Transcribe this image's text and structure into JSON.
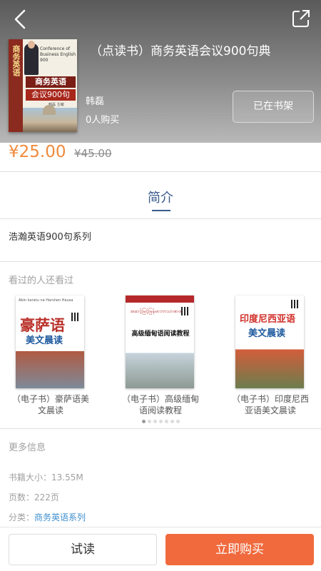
{
  "header": {
    "back_icon": "chevron-left-icon",
    "share_icon": "share-out-icon",
    "book": {
      "title": "（点读书）商务英语会议900句典",
      "author": "韩磊",
      "buyers": "0人购买",
      "shelf_button": "已在书架",
      "cover": {
        "spine_text": "商务英语",
        "en_text": "Conference of Business English 900",
        "title_line1": "商务英语",
        "title_line2": "会议900句",
        "author": "韩磊 主编"
      }
    }
  },
  "price": {
    "current": "¥25.00",
    "original": "¥45.00",
    "accent_color": "#f08a3c"
  },
  "tabs": {
    "intro": "简介"
  },
  "intro": {
    "text": "浩瀚英语900句系列"
  },
  "recommend": {
    "label": "看过的人还看过",
    "items": [
      {
        "caption": "（电子书）豪萨语美文晨读",
        "cover_small": "Abin karatu na Harshen Hausa",
        "cover_title_red": "豪萨语",
        "cover_title_blue": "美文晨读"
      },
      {
        "caption": "（电子书）高级缅甸语阅读教程",
        "cover_burmese": "အဆင့်မြင့်မြန်မာဘာသာစာဖတ်",
        "cover_title": "高级缅甸语阅读教程"
      },
      {
        "caption": "（电子书）印度尼西亚语美文晨读",
        "cover_title_red": "印度尼西亚语",
        "cover_title_blue": "美文晨读"
      }
    ],
    "page_dots": 7,
    "active_dot": 0
  },
  "more_info": {
    "label": "更多信息",
    "size_label": "书籍大小：",
    "size_value": "13.55M",
    "pages_label": "页数：",
    "pages_value": "222页",
    "category_label": "分类：",
    "category_value": "商务英语系列",
    "link_color": "#3e8fcf"
  },
  "footer": {
    "trial_button": "试读",
    "buy_button": "立即购买",
    "buy_color": "#f06a3e"
  }
}
